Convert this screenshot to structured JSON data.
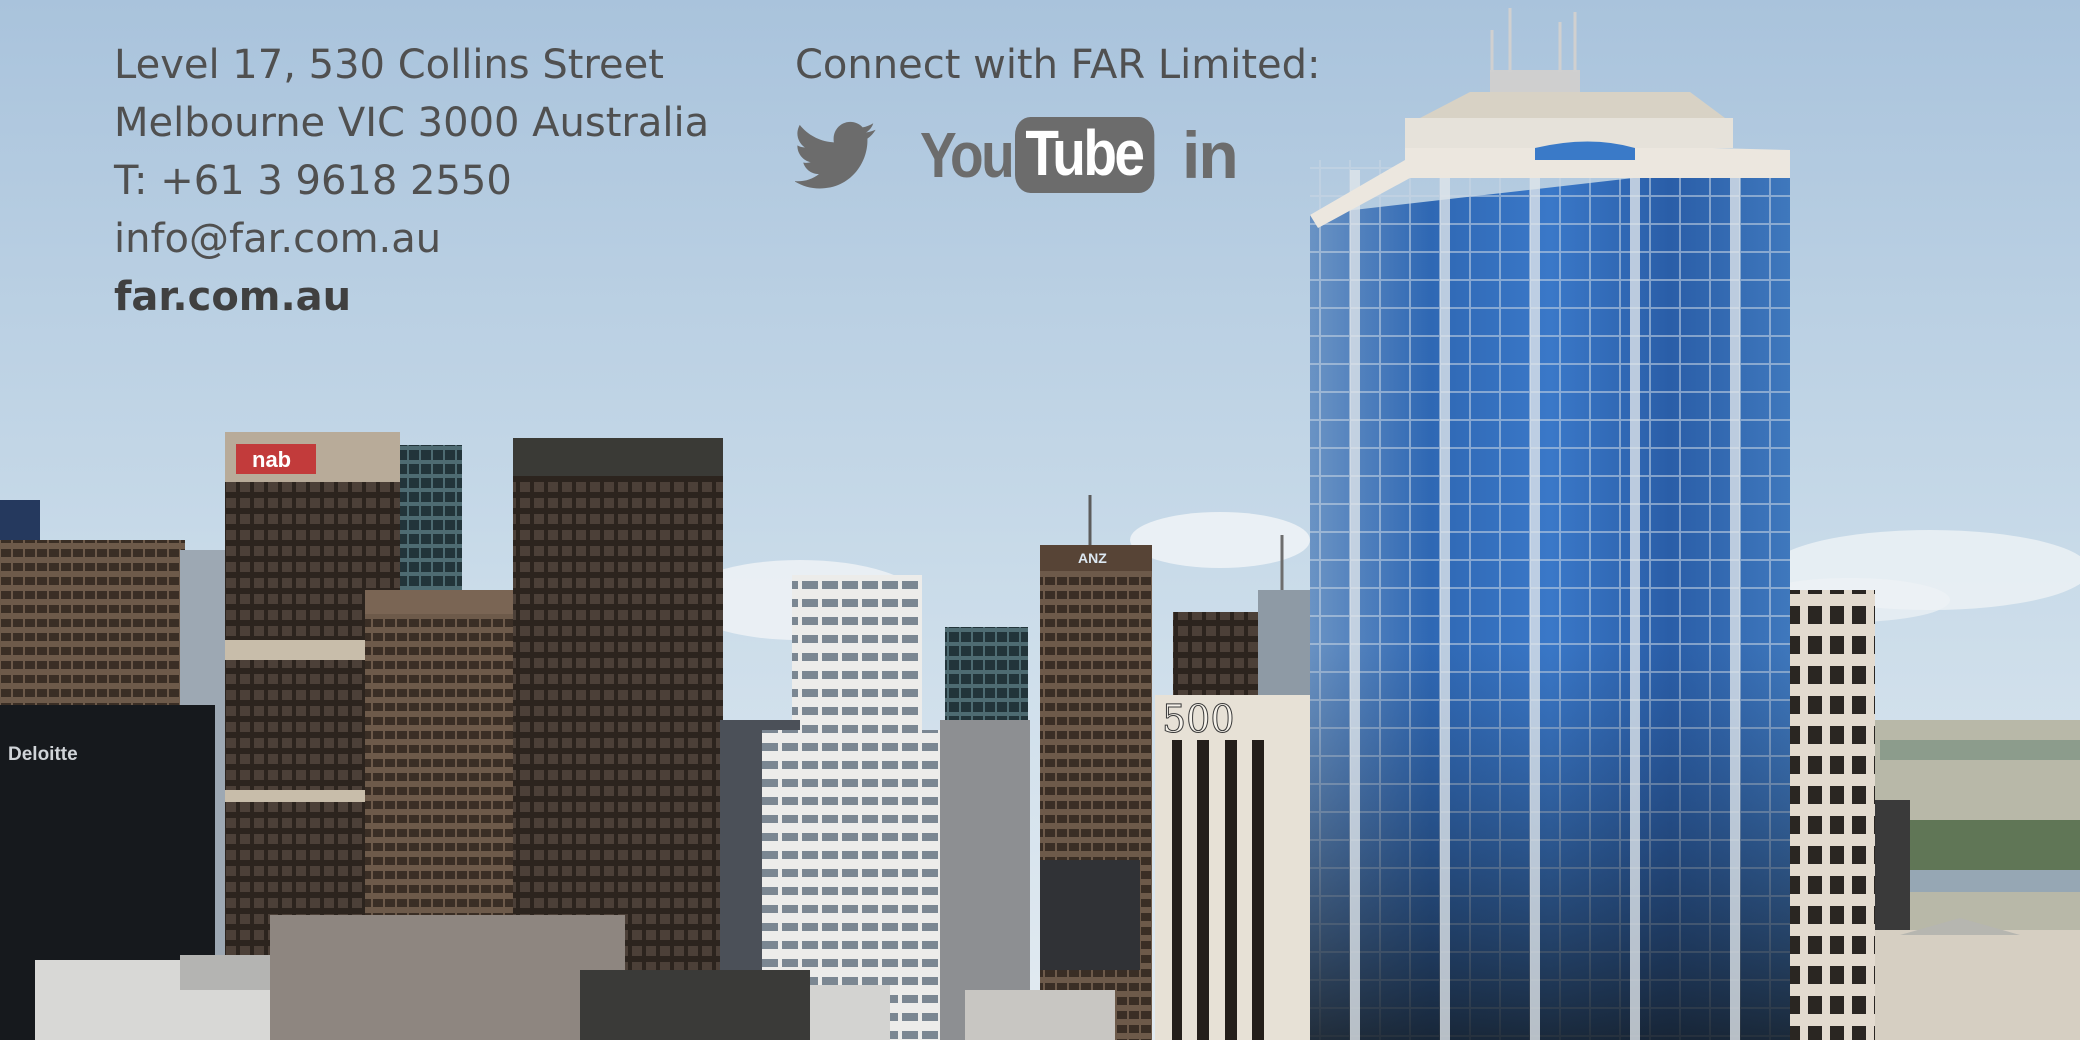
{
  "contact": {
    "address_line1": "Level 17, 530 Collins Street",
    "address_line2": "Melbourne  VIC 3000 Australia",
    "phone": "T:  +61 3 9618 2550",
    "email": "info@far.com.au",
    "website": "far.com.au"
  },
  "connect": {
    "heading": "Connect with FAR Limited:",
    "youtube_you": "You",
    "youtube_tube": "Tube",
    "linkedin": "in"
  },
  "skyline": {
    "signs": {
      "nab": "nab",
      "anz": "ANZ",
      "deloitte": "Deloitte",
      "five_hundred": "500"
    }
  },
  "colors": {
    "sky_top": "#aec6dd",
    "sky_bottom": "#dfe9f1",
    "text": "#505050",
    "icon_gray": "#6c6c6c",
    "glass_blue": "#2d5fa6"
  }
}
